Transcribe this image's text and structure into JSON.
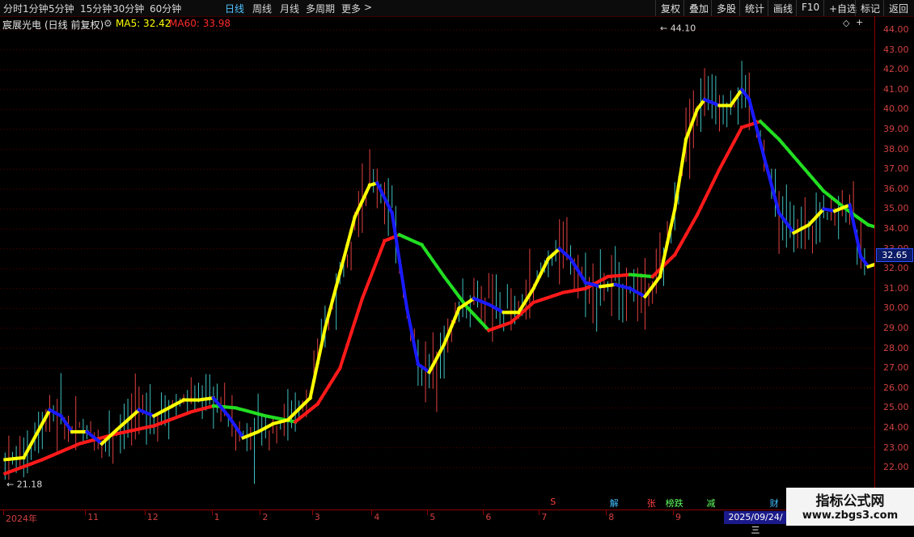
{
  "toolbar": {
    "periods": [
      "分时",
      "1分钟",
      "5分钟",
      "15分钟",
      "30分钟",
      "60分钟",
      "日线",
      "周线",
      "月线",
      "多周期",
      "更多"
    ],
    "active_period": "日线",
    "more_arrow": ">",
    "right_buttons": [
      "复权",
      "叠加",
      "多股",
      "统计",
      "画线",
      "F10",
      "+自选",
      "标记",
      "返回"
    ]
  },
  "info": {
    "stock_name": "宸展光电",
    "period_label": "(日线 前复权)",
    "ma5_label": "MA5: 32.42",
    "ma60_label": "MA60: 33.98",
    "ma5_color": "#ffff00",
    "ma60_color": "#ff2a2a",
    "settings_icon": "gear-icon"
  },
  "colors": {
    "up_candle": "#e04040",
    "down_candle": "#40c0c0",
    "ma5_up": "#ffff00",
    "ma5_down": "#1a1aff",
    "ma60_up": "#ff1a1a",
    "ma60_down": "#22dd22",
    "grid": "#5a0000"
  },
  "chart_data": {
    "type": "candlestick",
    "y_ticks": [
      22.0,
      23.0,
      24.0,
      25.0,
      26.0,
      27.0,
      28.0,
      29.0,
      30.0,
      31.0,
      32.0,
      33.0,
      34.0,
      35.0,
      36.0,
      37.0,
      38.0,
      39.0,
      40.0,
      41.0,
      42.0,
      43.0,
      44.0
    ],
    "y_tick_labels": [
      "22.00",
      "23.00",
      "24.00",
      "25.00",
      "26.00",
      "27.00",
      "28.00",
      "29.00",
      "30.00",
      "31.00",
      "32.00",
      "33.00",
      "34.00",
      "35.00",
      "36.00",
      "37.00",
      "38.00",
      "39.00",
      "40.00",
      "41.00",
      "42.00",
      "43.00",
      "44.00"
    ],
    "ylim": [
      21.0,
      45.0
    ],
    "x_labels": [
      "2024年",
      "11",
      "12",
      "1",
      "2",
      "3",
      "4",
      "5",
      "6",
      "7",
      "8",
      "9"
    ],
    "x_label_bar_index": [
      0,
      22,
      38,
      56,
      69,
      83,
      99,
      114,
      129,
      144,
      162,
      180
    ],
    "bar_count": 232,
    "current_price": "32.65",
    "max_annotation": "44.10",
    "min_annotation": "21.18",
    "cursor_date": "2025/09/24/三",
    "ma5_path": [
      [
        0,
        22.4
      ],
      [
        5,
        22.5
      ],
      [
        12,
        24.9
      ],
      [
        15,
        24.6
      ],
      [
        18,
        23.8
      ],
      [
        22,
        23.8
      ],
      [
        26,
        23.2
      ],
      [
        30,
        23.9
      ],
      [
        36,
        24.9
      ],
      [
        40,
        24.6
      ],
      [
        44,
        25.0
      ],
      [
        48,
        25.4
      ],
      [
        52,
        25.4
      ],
      [
        56,
        25.5
      ],
      [
        60,
        24.6
      ],
      [
        64,
        23.5
      ],
      [
        68,
        23.8
      ],
      [
        72,
        24.2
      ],
      [
        76,
        24.4
      ],
      [
        82,
        25.5
      ],
      [
        86,
        29.0
      ],
      [
        90,
        31.8
      ],
      [
        94,
        34.6
      ],
      [
        98,
        36.2
      ],
      [
        100,
        36.3
      ],
      [
        104,
        34.8
      ],
      [
        108,
        30.0
      ],
      [
        111,
        27.2
      ],
      [
        114,
        26.8
      ],
      [
        118,
        28.2
      ],
      [
        122,
        30.0
      ],
      [
        126,
        30.5
      ],
      [
        130,
        30.2
      ],
      [
        134,
        29.8
      ],
      [
        138,
        29.8
      ],
      [
        142,
        31.0
      ],
      [
        146,
        32.5
      ],
      [
        149,
        33.0
      ],
      [
        152,
        32.5
      ],
      [
        156,
        31.3
      ],
      [
        160,
        31.1
      ],
      [
        164,
        31.2
      ],
      [
        168,
        31.0
      ],
      [
        172,
        30.6
      ],
      [
        176,
        31.6
      ],
      [
        180,
        35.0
      ],
      [
        183,
        38.5
      ],
      [
        186,
        40.0
      ],
      [
        188,
        40.5
      ],
      [
        192,
        40.2
      ],
      [
        195,
        40.2
      ],
      [
        198,
        41.0
      ],
      [
        200,
        40.5
      ],
      [
        204,
        37.6
      ],
      [
        208,
        34.8
      ],
      [
        212,
        33.8
      ],
      [
        216,
        34.2
      ],
      [
        220,
        35.0
      ],
      [
        223,
        34.9
      ],
      [
        227,
        35.2
      ],
      [
        230,
        32.6
      ],
      [
        232,
        32.1
      ],
      [
        235,
        32.3
      ]
    ],
    "ma60_path": [
      [
        0,
        21.7
      ],
      [
        10,
        22.4
      ],
      [
        20,
        23.2
      ],
      [
        30,
        23.7
      ],
      [
        40,
        24.1
      ],
      [
        50,
        24.8
      ],
      [
        56,
        25.1
      ],
      [
        62,
        25.0
      ],
      [
        70,
        24.6
      ],
      [
        78,
        24.3
      ],
      [
        84,
        25.2
      ],
      [
        90,
        27.0
      ],
      [
        96,
        30.5
      ],
      [
        102,
        33.4
      ],
      [
        106,
        33.7
      ],
      [
        112,
        33.2
      ],
      [
        118,
        31.6
      ],
      [
        124,
        30.1
      ],
      [
        130,
        28.9
      ],
      [
        136,
        29.3
      ],
      [
        142,
        30.3
      ],
      [
        150,
        30.8
      ],
      [
        156,
        31.0
      ],
      [
        162,
        31.6
      ],
      [
        168,
        31.7
      ],
      [
        174,
        31.6
      ],
      [
        180,
        32.7
      ],
      [
        186,
        34.7
      ],
      [
        192,
        37.0
      ],
      [
        198,
        39.1
      ],
      [
        203,
        39.4
      ],
      [
        208,
        38.5
      ],
      [
        214,
        37.2
      ],
      [
        220,
        35.9
      ],
      [
        226,
        35.0
      ],
      [
        232,
        34.2
      ],
      [
        236,
        33.98
      ]
    ],
    "candles_seed_note": "",
    "marks": [
      {
        "text": "S",
        "bar": 147,
        "color": "#ff4040"
      },
      {
        "text": "解",
        "bar": 163,
        "color": "#40c0ff"
      },
      {
        "text": "张",
        "bar": 173,
        "color": "#ff4040"
      },
      {
        "text": "榜跌",
        "bar": 178,
        "color": "#60ff60"
      },
      {
        "text": "减",
        "bar": 189,
        "color": "#60ff60"
      },
      {
        "text": "财",
        "bar": 206,
        "color": "#40c0ff"
      }
    ]
  },
  "watermark": {
    "title": "指标公式网",
    "url": "www.zbgs3.com"
  },
  "chart_icons": {
    "diamond": "◇",
    "plus": "+"
  }
}
